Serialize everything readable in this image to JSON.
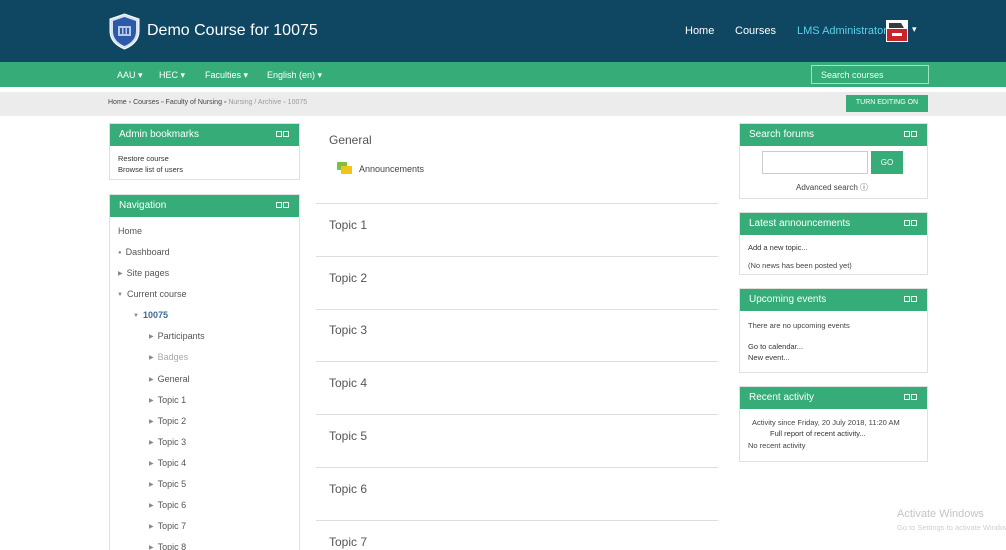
{
  "header": {
    "site_title": "Demo Course for 10075",
    "nav": [
      "Home",
      "Courses"
    ],
    "user": "LMS Administrator",
    "caret": "▾"
  },
  "menu": {
    "items": [
      "AAU ▾",
      "HEC ▾",
      "Faculties ▾",
      "English (en) ▾"
    ],
    "search_placeholder": "Search courses"
  },
  "breadcrumb": {
    "home": "Home",
    "sep": "▫",
    "courses": "Courses",
    "faculty": "Faculty of Nursing",
    "archive": "Nursing / Archive",
    "current": "10075"
  },
  "turn_editing": "TURN EDITING ON",
  "admin_bookmarks": {
    "title": "Admin bookmarks",
    "links": [
      "Restore course",
      "Browse list of users"
    ]
  },
  "navigation": {
    "title": "Navigation",
    "home": "Home",
    "dashboard": "Dashboard",
    "site_pages": "Site pages",
    "current_course": "Current course",
    "course": "10075",
    "children": [
      "Participants",
      "Badges",
      "General",
      "Topic 1",
      "Topic 2",
      "Topic 3",
      "Topic 4",
      "Topic 5",
      "Topic 6",
      "Topic 7",
      "Topic 8"
    ]
  },
  "main": {
    "general": "General",
    "announcements": "Announcements",
    "topics": [
      "Topic 1",
      "Topic 2",
      "Topic 3",
      "Topic 4",
      "Topic 5",
      "Topic 6",
      "Topic 7"
    ]
  },
  "search_forums": {
    "title": "Search forums",
    "go": "GO",
    "advanced": "Advanced search ⓘ"
  },
  "latest_announcements": {
    "title": "Latest announcements",
    "add": "Add a new topic...",
    "none": "(No news has been posted yet)"
  },
  "upcoming_events": {
    "title": "Upcoming events",
    "none": "There are no upcoming events",
    "calendar": "Go to calendar...",
    "new_event": "New event..."
  },
  "recent_activity": {
    "title": "Recent activity",
    "since": "Activity since Friday, 20 July 2018, 11:20 AM",
    "full_report": "Full report of recent activity...",
    "none": "No recent activity"
  },
  "watermark": {
    "line1": "Activate Windows",
    "line2": "Go to Settings to activate Windows."
  },
  "colors": {
    "topbar": "#0f4762",
    "green": "#36ad79",
    "user_link": "#5bd0e8"
  },
  "icons": [
    "university-logo-icon",
    "user-avatar-icon",
    "forum-icon",
    "block-controls-icon"
  ]
}
